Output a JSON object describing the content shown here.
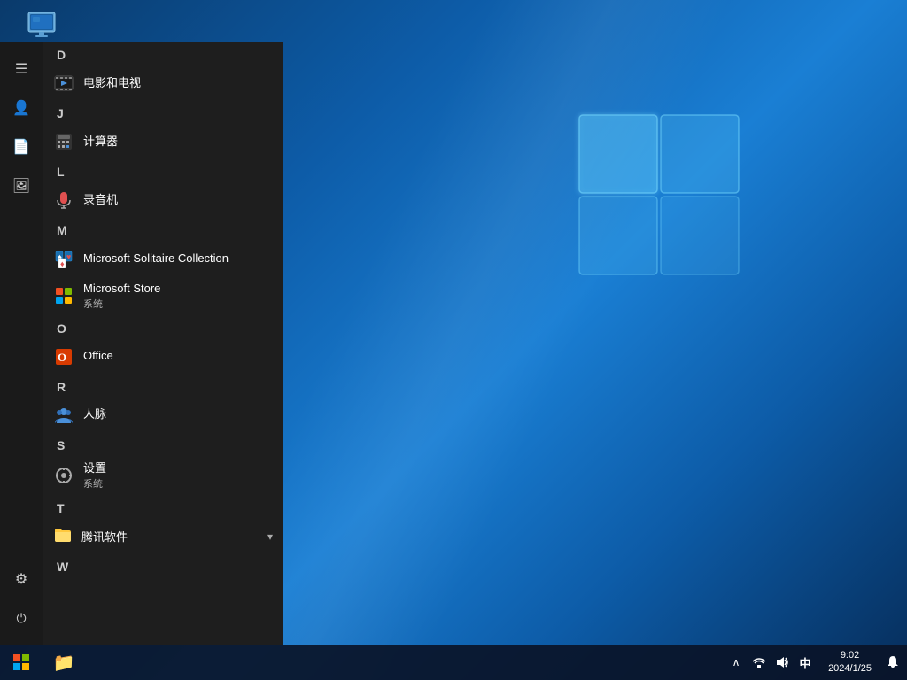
{
  "desktop": {
    "icon_label": "此电脑"
  },
  "start_menu": {
    "hamburger_label": "☰",
    "sections": [
      {
        "letter": "D",
        "items": [
          {
            "name": "电影和电视",
            "sub": "",
            "icon": "film",
            "type": "app"
          }
        ]
      },
      {
        "letter": "J",
        "items": [
          {
            "name": "计算器",
            "sub": "",
            "icon": "calc",
            "type": "app"
          }
        ]
      },
      {
        "letter": "L",
        "items": [
          {
            "name": "录音机",
            "sub": "",
            "icon": "mic",
            "type": "app"
          }
        ]
      },
      {
        "letter": "M",
        "items": [
          {
            "name": "Microsoft Solitaire Collection",
            "sub": "",
            "icon": "cards",
            "type": "app"
          },
          {
            "name": "Microsoft Store",
            "sub": "系统",
            "icon": "store",
            "type": "app"
          }
        ]
      },
      {
        "letter": "O",
        "items": [
          {
            "name": "Office",
            "sub": "",
            "icon": "office",
            "type": "app"
          }
        ]
      },
      {
        "letter": "R",
        "items": [
          {
            "name": "人脉",
            "sub": "",
            "icon": "people",
            "type": "app"
          }
        ]
      },
      {
        "letter": "S",
        "items": [
          {
            "name": "设置",
            "sub": "系统",
            "icon": "settings",
            "type": "app"
          }
        ]
      },
      {
        "letter": "T",
        "items": [
          {
            "name": "腾讯软件",
            "sub": "",
            "icon": "folder",
            "type": "folder"
          }
        ]
      },
      {
        "letter": "W",
        "items": []
      }
    ]
  },
  "sidebar": {
    "top_icon": "☰",
    "icons": [
      {
        "name": "user-icon",
        "glyph": "👤"
      },
      {
        "name": "document-icon",
        "glyph": "📄"
      },
      {
        "name": "photos-icon",
        "glyph": "🖼"
      },
      {
        "name": "settings-icon",
        "glyph": "⚙"
      },
      {
        "name": "power-icon",
        "glyph": "⏻"
      }
    ]
  },
  "taskbar": {
    "start_icon": "⊞",
    "file_explorer_icon": "📁",
    "tray": {
      "chevron": "∧",
      "ime": "中",
      "volume": "🔊",
      "network": "🌐",
      "time": "9:02",
      "date": "2024/1/25",
      "notification": "🗨"
    }
  }
}
